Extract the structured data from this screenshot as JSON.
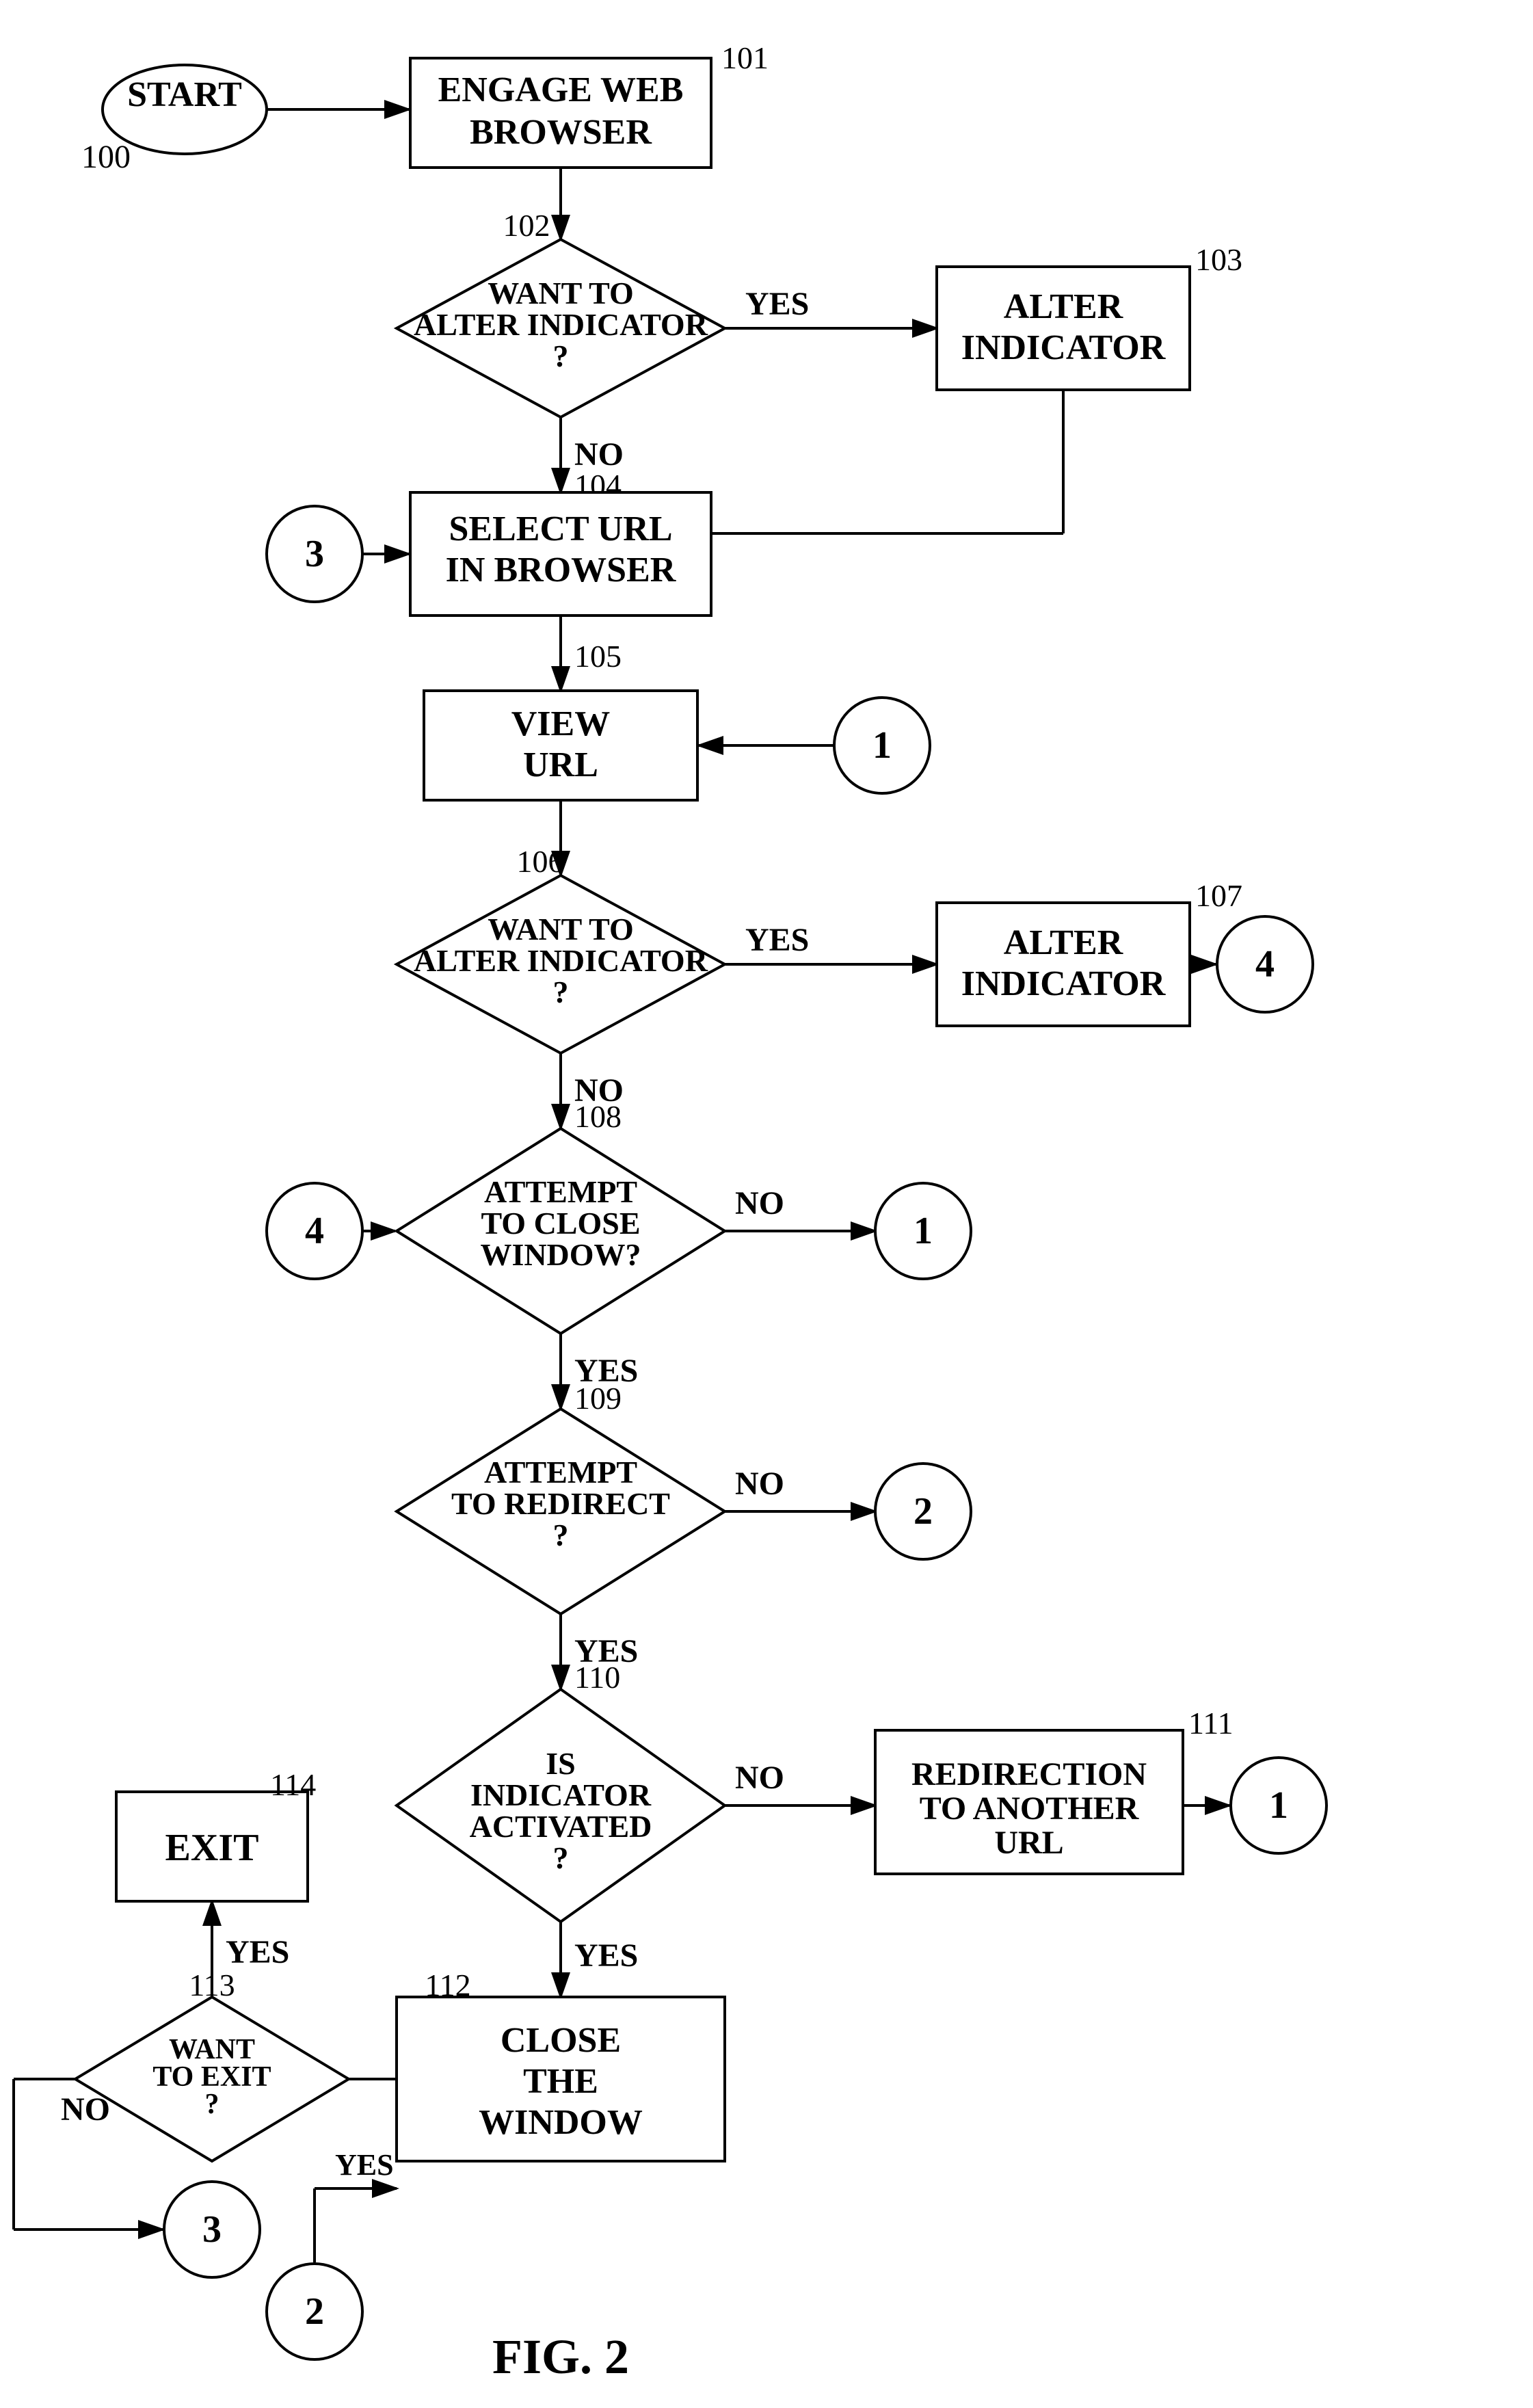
{
  "diagram": {
    "title": "FIG. 2",
    "nodes": [
      {
        "id": "start",
        "type": "oval",
        "label": "START",
        "ref": "100"
      },
      {
        "id": "101",
        "type": "rect",
        "label": "ENGAGE WEB\nBROWSER",
        "ref": "101"
      },
      {
        "id": "102",
        "type": "diamond",
        "label": "WANT TO\nALTER INDICATOR\n?",
        "ref": "102"
      },
      {
        "id": "103",
        "type": "rect",
        "label": "ALTER\nINDICATOR",
        "ref": "103"
      },
      {
        "id": "104",
        "type": "rect",
        "label": "SELECT URL\nIN BROWSER",
        "ref": "104"
      },
      {
        "id": "105",
        "type": "rect",
        "label": "VIEW\nURL",
        "ref": "105"
      },
      {
        "id": "circle1a",
        "type": "circle",
        "label": "1"
      },
      {
        "id": "circle3a",
        "type": "circle",
        "label": "3"
      },
      {
        "id": "106",
        "type": "diamond",
        "label": "WANT TO\nALTER INDICATOR\n?",
        "ref": "106"
      },
      {
        "id": "107",
        "type": "rect",
        "label": "ALTER\nINDICATOR",
        "ref": "107"
      },
      {
        "id": "circle4a",
        "type": "circle",
        "label": "4"
      },
      {
        "id": "108",
        "type": "diamond",
        "label": "ATTEMPT\nTO CLOSE\nWINDOW?",
        "ref": "108"
      },
      {
        "id": "circle4b",
        "type": "circle",
        "label": "4"
      },
      {
        "id": "circle1b",
        "type": "circle",
        "label": "1"
      },
      {
        "id": "109",
        "type": "diamond",
        "label": "ATTEMPT\nTO REDIRECT\n?",
        "ref": "109"
      },
      {
        "id": "circle2a",
        "type": "circle",
        "label": "2"
      },
      {
        "id": "110",
        "type": "diamond",
        "label": "IS\nINDICATOR\nACTIVATED\n?",
        "ref": "110"
      },
      {
        "id": "111",
        "type": "rect",
        "label": "REDIRECTION\nTO ANOTHER\nURL",
        "ref": "111"
      },
      {
        "id": "circle1c",
        "type": "circle",
        "label": "1"
      },
      {
        "id": "112",
        "type": "rect",
        "label": "CLOSE\nTHE\nWINDOW",
        "ref": "112"
      },
      {
        "id": "113",
        "type": "diamond",
        "label": "WANT\nTO EXIT\n?",
        "ref": "113"
      },
      {
        "id": "circle3b",
        "type": "circle",
        "label": "3"
      },
      {
        "id": "114",
        "type": "rect",
        "label": "EXIT",
        "ref": "114"
      },
      {
        "id": "circle2b",
        "type": "circle",
        "label": "2"
      }
    ]
  }
}
